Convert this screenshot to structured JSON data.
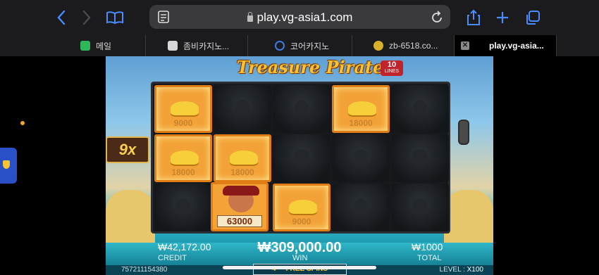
{
  "browser": {
    "url": "play.vg-asia1.com",
    "tabs": [
      {
        "label": "메일",
        "favicon_color": "#2fb85a",
        "active": false
      },
      {
        "label": "좀비카지노...",
        "favicon_color": "#d8d8d8",
        "active": false
      },
      {
        "label": "코어카지노",
        "favicon_color": "#3d7be0",
        "active": false
      },
      {
        "label": "zb-6518.co...",
        "favicon_color": "#d8b02a",
        "active": false
      },
      {
        "label": "play.vg-asia...",
        "favicon_color": "#888888",
        "active": true
      }
    ]
  },
  "game": {
    "title": "Treasure Pirate",
    "lines_badge": {
      "number": "10",
      "text": "LINES"
    },
    "multiplier": "9x",
    "reels": [
      [
        {
          "type": "gold",
          "value": "9000"
        },
        {
          "type": "gold",
          "value": "18000"
        },
        {
          "type": "dark"
        }
      ],
      [
        {
          "type": "dark"
        },
        {
          "type": "gold",
          "value": "18000"
        },
        {
          "type": "pirate",
          "value": "63000"
        }
      ],
      [
        {
          "type": "dark"
        },
        {
          "type": "dark"
        },
        {
          "type": "gold",
          "value": "9000"
        }
      ],
      [
        {
          "type": "gold",
          "value": "18000"
        },
        {
          "type": "dark"
        },
        {
          "type": "dark"
        }
      ],
      [
        {
          "type": "dark"
        },
        {
          "type": "dark"
        },
        {
          "type": "dark"
        }
      ]
    ],
    "credit": {
      "value": "₩42,172.00",
      "label": "CREDIT"
    },
    "win": {
      "value": "₩309,000.00",
      "label": "WIN"
    },
    "total": {
      "value": "₩1000",
      "label": "TOTAL"
    },
    "session_id": "757211154380",
    "free_spins_label": "FREE SPINS",
    "free_spins_count": "4",
    "level": {
      "label": "LEVEL :",
      "value": "X100"
    }
  },
  "colors": {
    "gold_cell": "#f3a237",
    "dark_cell": "#1a1d20",
    "accent_text": "#f6c232"
  }
}
